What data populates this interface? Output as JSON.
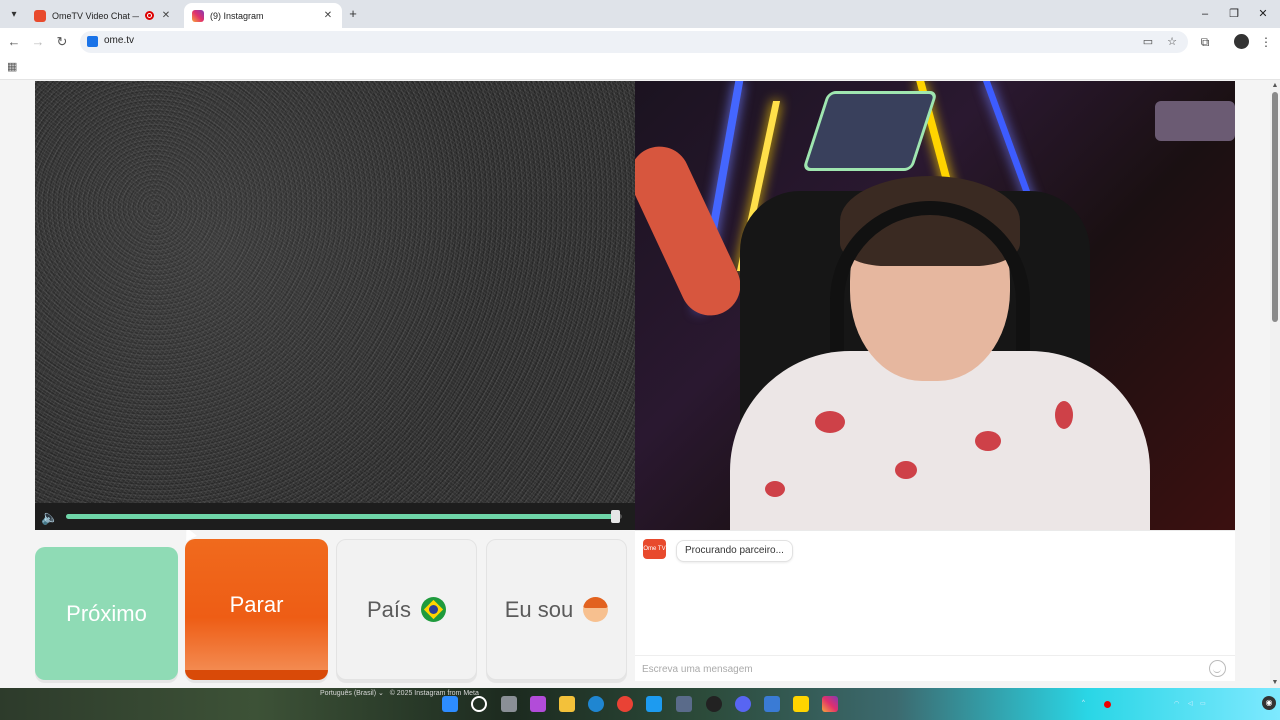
{
  "browser": {
    "tabs": [
      {
        "title": "OmeTV Video Chat — Ome",
        "favicon": "ometv-icon",
        "recording": true
      },
      {
        "title": "(9) Instagram",
        "favicon": "instagram-icon",
        "active": true
      }
    ],
    "url": "ome.tv"
  },
  "video": {
    "volume_fraction": 0.99
  },
  "buttons": {
    "next": "Próximo",
    "stop": "Parar",
    "country": "País",
    "gender": "Eu sou"
  },
  "chat": {
    "logo_text": "Ome TV",
    "status_message": "Procurando parceiro...",
    "input_placeholder": "Escreva uma mensagem"
  },
  "footer": {
    "language": "Português (Brasil)",
    "copyright": "© 2025 Instagram from Meta"
  },
  "colors": {
    "next_button": "#8fdbb5",
    "stop_button": "#f06a1d",
    "neutral_button": "#f2f2f2",
    "volume_fill": "#6fd6a9"
  }
}
